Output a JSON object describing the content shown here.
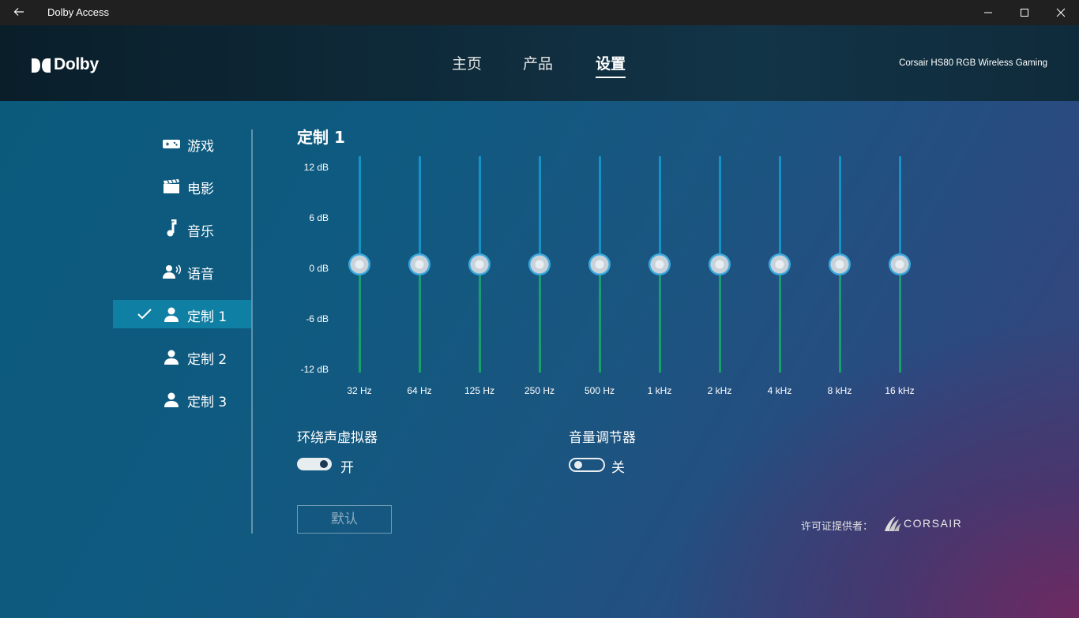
{
  "window": {
    "title": "Dolby Access"
  },
  "header": {
    "logo_text": "Dolby",
    "tabs": [
      {
        "label": "主页",
        "active": false
      },
      {
        "label": "产品",
        "active": false
      },
      {
        "label": "设置",
        "active": true
      }
    ],
    "device_name": "Corsair HS80 RGB Wireless Gaming"
  },
  "sidebar": {
    "items": [
      {
        "label": "游戏",
        "icon": "gamepad-icon",
        "active": false
      },
      {
        "label": "电影",
        "icon": "clapperboard-icon",
        "active": false
      },
      {
        "label": "音乐",
        "icon": "music-note-icon",
        "active": false
      },
      {
        "label": "语音",
        "icon": "voice-icon",
        "active": false
      },
      {
        "label": "定制 1",
        "icon": "person-icon",
        "active": true
      },
      {
        "label": "定制 2",
        "icon": "person-icon",
        "active": false
      },
      {
        "label": "定制 3",
        "icon": "person-icon",
        "active": false
      }
    ]
  },
  "equalizer": {
    "title": "定制 1",
    "db_labels": [
      "12 dB",
      "6 dB",
      "0 dB",
      "-6 dB",
      "-12 dB"
    ],
    "bands": [
      {
        "label": "32 Hz",
        "gain_db": 0
      },
      {
        "label": "64 Hz",
        "gain_db": 0
      },
      {
        "label": "125 Hz",
        "gain_db": 0
      },
      {
        "label": "250 Hz",
        "gain_db": 0
      },
      {
        "label": "500 Hz",
        "gain_db": 0
      },
      {
        "label": "1 kHz",
        "gain_db": 0
      },
      {
        "label": "2 kHz",
        "gain_db": 0
      },
      {
        "label": "4 kHz",
        "gain_db": 0
      },
      {
        "label": "8 kHz",
        "gain_db": 0
      },
      {
        "label": "16 kHz",
        "gain_db": 0
      }
    ],
    "range_db": [
      -12,
      12
    ]
  },
  "settings": {
    "virtualizer": {
      "title": "环绕声虚拟器",
      "state": "开",
      "on": true
    },
    "volume_leveler": {
      "title": "音量调节器",
      "state": "关",
      "on": false
    }
  },
  "default_button": "默认",
  "license": {
    "label": "许可证提供者：",
    "brand": "CORSAIR"
  },
  "colors": {
    "accent": "#0f7fa3",
    "track_upper": "#1592c8",
    "track_lower": "#1b9a78"
  }
}
